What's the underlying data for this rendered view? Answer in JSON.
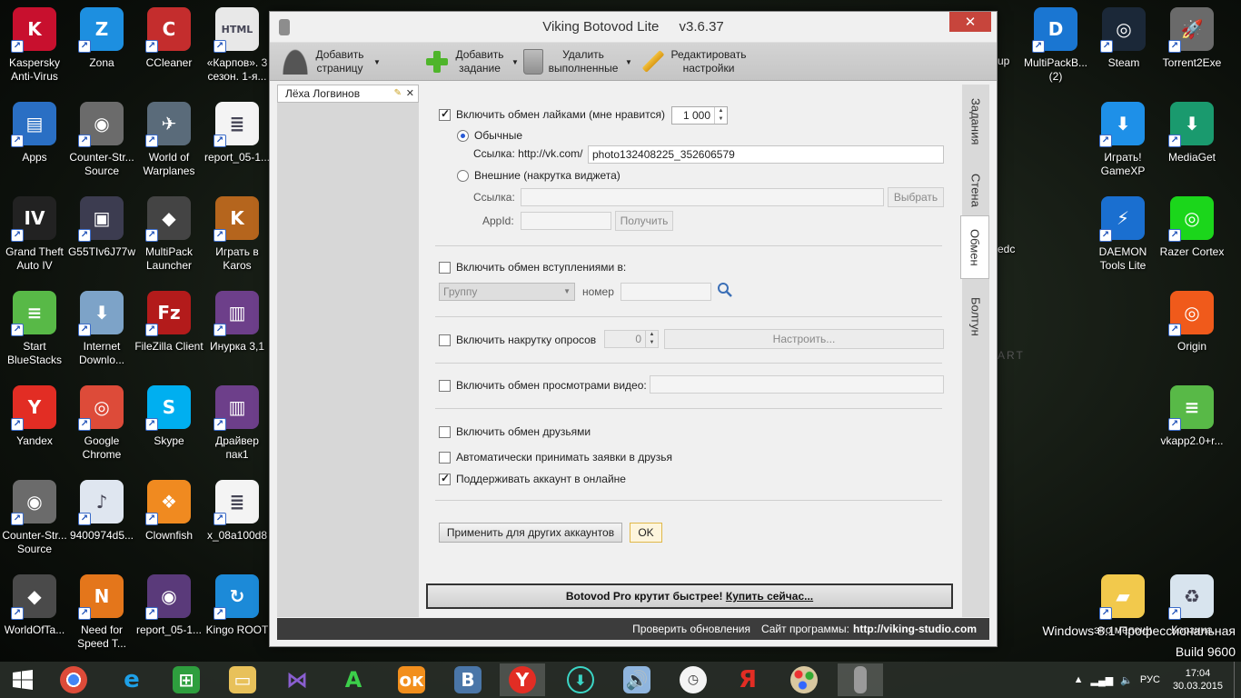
{
  "desktop": {
    "icons_col1": [
      {
        "label": "Kaspersky Anti-Virus",
        "color": "#c8102e",
        "glyph": "K"
      },
      {
        "label": "Apps",
        "color": "#2a6fc4",
        "glyph": "▤"
      },
      {
        "label": "Grand Theft Auto IV",
        "color": "#222222",
        "glyph": "IV"
      },
      {
        "label": "Start BlueStacks",
        "color": "#58b947",
        "glyph": "≡"
      },
      {
        "label": "Yandex",
        "color": "#e22d24",
        "glyph": "Y"
      },
      {
        "label": "Counter-Str... Source",
        "color": "#6b6b6b",
        "glyph": "◉"
      },
      {
        "label": "WorldOfTa...",
        "color": "#4a4a4a",
        "glyph": "◆"
      }
    ],
    "icons_col2": [
      {
        "label": "Zona",
        "color": "#1d8fe0",
        "glyph": "Z"
      },
      {
        "label": "Counter-Str... Source",
        "color": "#6b6b6b",
        "glyph": "◉"
      },
      {
        "label": "G55TIv6J77w",
        "color": "#3c3c50",
        "glyph": "▣"
      },
      {
        "label": "Internet Downlo...",
        "color": "#7da3c8",
        "glyph": "⬇"
      },
      {
        "label": "Google Chrome",
        "color": "#dd4b39",
        "glyph": "◎"
      },
      {
        "label": "9400974d5...",
        "color": "#dfe6f0",
        "glyph": "♪"
      },
      {
        "label": "Need for Speed T...",
        "color": "#e4761b",
        "glyph": "N"
      }
    ],
    "icons_col3": [
      {
        "label": "CCleaner",
        "color": "#c42d2d",
        "glyph": "C"
      },
      {
        "label": "World of Warplanes",
        "color": "#5a6b7a",
        "glyph": "✈"
      },
      {
        "label": "MultiPack Launcher",
        "color": "#444444",
        "glyph": "◆"
      },
      {
        "label": "FileZilla Client",
        "color": "#b31b1b",
        "glyph": "Fz"
      },
      {
        "label": "Skype",
        "color": "#00aff0",
        "glyph": "S"
      },
      {
        "label": "Clownfish",
        "color": "#f08a20",
        "glyph": "❖"
      },
      {
        "label": "report_05-1...",
        "color": "#5a3a7a",
        "glyph": "◉"
      }
    ],
    "icons_col4": [
      {
        "label": "«Карпов». 3 сезон. 1-я...",
        "color": "#e8e8e8",
        "glyph": "HTML"
      },
      {
        "label": "report_05-1...",
        "color": "#f4f4f4",
        "glyph": "≣"
      },
      {
        "label": "Играть в Karos",
        "color": "#b5651d",
        "glyph": "K"
      },
      {
        "label": "Инурка 3,1",
        "color": "#6d3f8a",
        "glyph": "▥"
      },
      {
        "label": "Драйвер пак1",
        "color": "#6d3f8a",
        "glyph": "▥"
      },
      {
        "label": "x_08a100d8",
        "color": "#f4f4f4",
        "glyph": "≣"
      },
      {
        "label": "Kingo ROOT",
        "color": "#1c8ad8",
        "glyph": "↻"
      }
    ],
    "icons_right_a": [
      {
        "label": "MultiPackB... (2)",
        "color": "#1a76d2",
        "glyph": "D"
      },
      {
        "label": "Steam",
        "color": "#1b2838",
        "glyph": "◎"
      },
      {
        "label": "Torrent2Exe",
        "color": "#6a6a6a",
        "glyph": "🚀"
      }
    ],
    "icons_right_b": [
      {
        "label": "Играть! GameXP",
        "color": "#1e90e8",
        "glyph": "⬇"
      },
      {
        "label": "MediaGet",
        "color": "#1a9a6e",
        "glyph": "⬇"
      },
      {
        "label": "DAEMON Tools Lite",
        "color": "#1a6fd0",
        "glyph": "⚡"
      },
      {
        "label": "Razer Cortex",
        "color": "#1bd61b",
        "glyph": "◎"
      },
      {
        "label": "Origin",
        "color": "#f05a1b",
        "glyph": "◎"
      },
      {
        "label": "vkapp2.0+r...",
        "color": "#58b947",
        "glyph": "≡"
      },
      {
        "label": "Корзина",
        "color": "#d8e4ee",
        "glyph": "♻"
      },
      {
        "label": "эпо мелочи",
        "color": "#f2c94c",
        "glyph": "▰"
      }
    ],
    "partial_labels": [
      "up",
      "edc",
      "ART"
    ],
    "windows_edition": "Windows 8.1 Профессиональная",
    "windows_build": "Build 9600"
  },
  "window": {
    "title": "Viking Botovod Lite",
    "version": "v3.6.37",
    "close_glyph": "✕"
  },
  "toolbar": {
    "add_page": "Добавить страницу",
    "add_task": "Добавить задание",
    "delete_done": "Удалить выполненные",
    "edit_settings": "Редактировать настройки"
  },
  "account_tab": {
    "name": "Лёха Логвинов",
    "close": "✕"
  },
  "side_tabs": [
    "Задания",
    "Стена",
    "Обмен",
    "Болтун"
  ],
  "likes": {
    "enable_label": "Включить обмен лайками (мне нравится)",
    "enabled": true,
    "count": "1 000",
    "normal_label": "Обычные",
    "link_label": "Ссылка: http://vk.com/",
    "link_value": "photo132408225_352606579",
    "external_label": "Внешние (накрутка виджета)",
    "ext_link_label": "Ссылка:",
    "choose_btn": "Выбрать",
    "appid_label": "AppId:",
    "get_btn": "Получить"
  },
  "joins": {
    "enable_label": "Включить обмен вступлениями в:",
    "enabled": false,
    "select_value": "Группу",
    "number_label": "номер",
    "search_icon": "search-icon"
  },
  "polls": {
    "enable_label": "Включить накрутку опросов",
    "enabled": false,
    "count": "0",
    "configure_btn": "Настроить..."
  },
  "video": {
    "enable_label": "Включить обмен просмотрами видео:",
    "enabled": false
  },
  "friends": {
    "enable_label": "Включить обмен друзьями",
    "enabled": false,
    "auto_accept_label": "Автоматически принимать заявки в друзья",
    "auto_accept": false,
    "online_label": "Поддерживать аккаунт в онлайне",
    "online": true
  },
  "actions": {
    "apply_btn": "Применить для других аккаунтов",
    "ok_btn": "OK"
  },
  "promo": {
    "text": "Botovod Pro крутит быстрее!",
    "link": "Купить сейчас..."
  },
  "statusbar": {
    "check_updates": "Проверить обновления",
    "site_label": "Сайт программы:",
    "site_url": "http://viking-studio.com"
  },
  "taskbar": {
    "language": "РУС",
    "time": "17:04",
    "date": "30.03.2015"
  },
  "colors": {
    "close": "#c7453c",
    "radio_accent": "#2a5bd7",
    "statusbar": "#3c3c3c"
  }
}
